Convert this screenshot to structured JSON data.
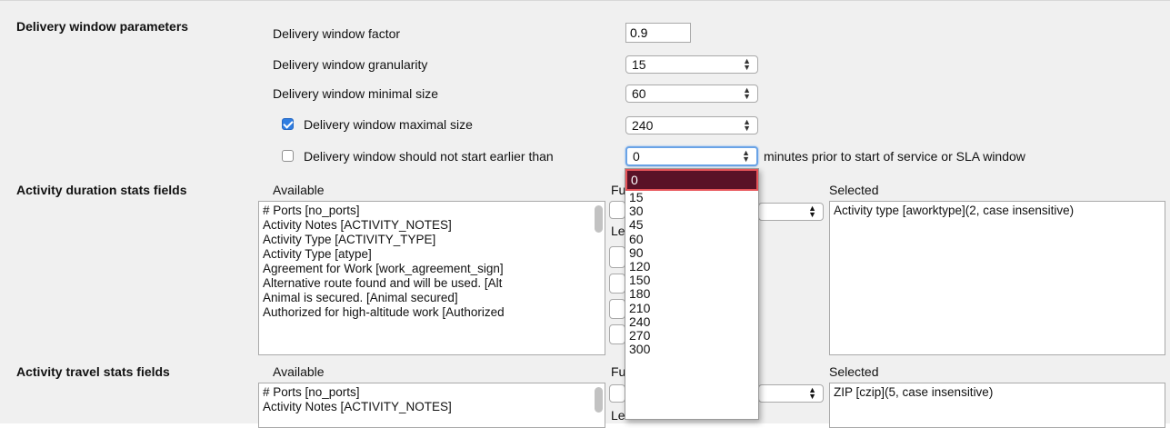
{
  "sections": {
    "delivery_window": "Delivery window parameters",
    "activity_duration": "Activity duration stats fields",
    "activity_travel": "Activity travel stats fields"
  },
  "delivery": {
    "factor_label": "Delivery window factor",
    "factor_value": "0.9",
    "granularity_label": "Delivery window granularity",
    "granularity_value": "15",
    "minimal_label": "Delivery window minimal size",
    "minimal_value": "60",
    "maximal_label": "Delivery window maximal size",
    "maximal_checked": true,
    "maximal_value": "240",
    "start_label": "Delivery window should not start earlier than",
    "start_checked": false,
    "start_value": "0",
    "start_suffix": "minutes prior to start of service or SLA window"
  },
  "dropdown_options": [
    "0",
    "15",
    "30",
    "45",
    "60",
    "90",
    "120",
    "150",
    "180",
    "210",
    "240",
    "270",
    "300"
  ],
  "duration": {
    "available_label": "Available",
    "function_label_clip": "Fu",
    "length_label_clip": "Le",
    "selected_label": "Selected",
    "available_items": [
      "# Ports [no_ports]",
      "Activity Notes [ACTIVITY_NOTES]",
      "Activity Type [ACTIVITY_TYPE]",
      "Activity Type [atype]",
      "Agreement for Work [work_agreement_sign]",
      "Alternative route found and will be used. [Alt",
      "Animal is secured. [Animal secured]",
      "Authorized for high-altitude work [Authorized"
    ],
    "selected_items": [
      "Activity type [aworktype](2, case insensitive)"
    ]
  },
  "travel": {
    "available_label": "Available",
    "function_label_clip": "Fu",
    "length_label_clip": "Le",
    "selected_label": "Selected",
    "available_items": [
      "# Ports [no_ports]",
      "Activity Notes [ACTIVITY_NOTES]"
    ],
    "selected_items": [
      "ZIP [czip](5, case insensitive)"
    ]
  },
  "icons": {
    "select_arrow": "updown-arrow-icon",
    "checkbox": "checkbox-icon"
  },
  "colors": {
    "highlight": "#5a1227",
    "highlight_outline": "#e8555a",
    "checkbox_on": "#2f7de1",
    "focus_ring": "#6aa3e6"
  }
}
